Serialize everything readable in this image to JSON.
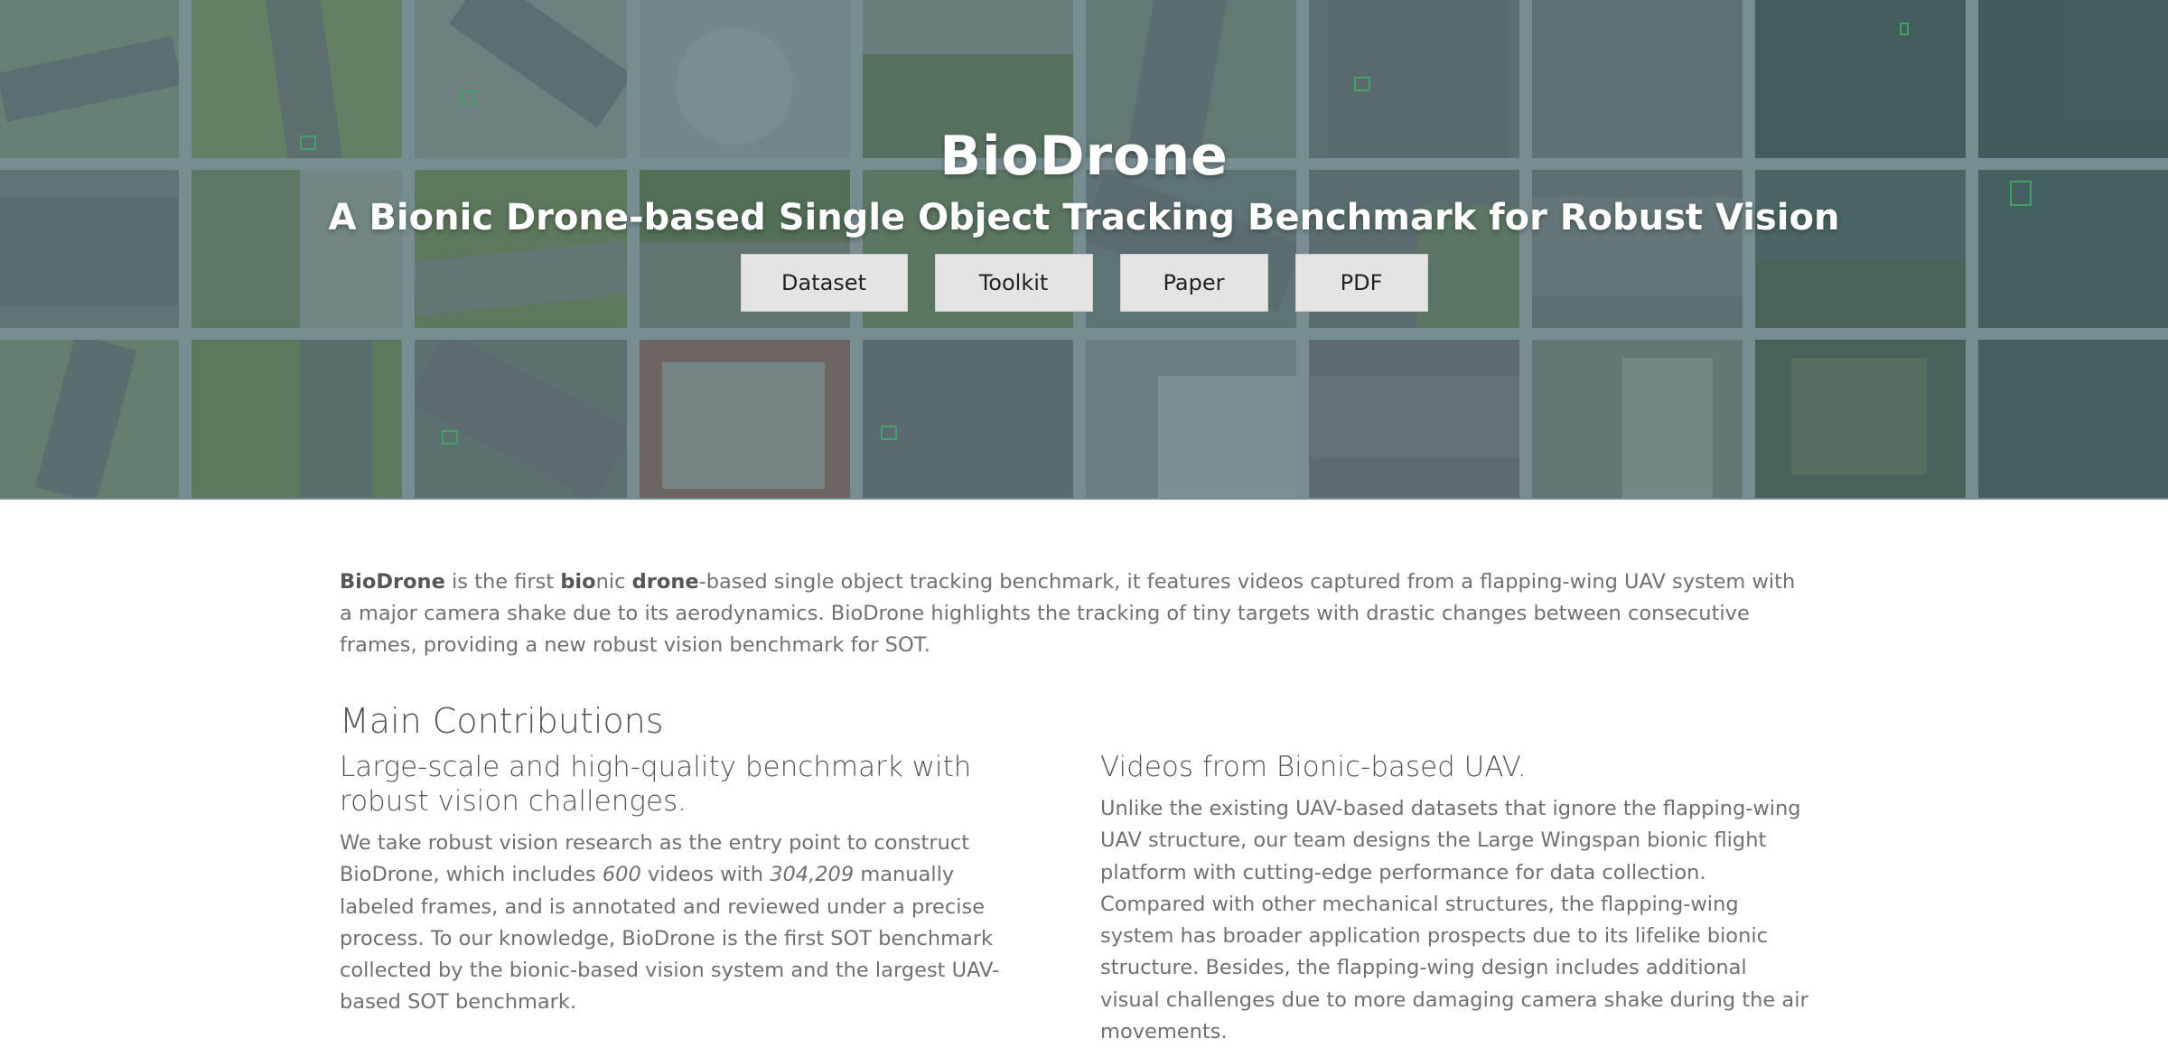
{
  "hero": {
    "title": "BioDrone",
    "subtitle": "A Bionic Drone-based Single Object Tracking Benchmark for Robust Vision",
    "buttons": [
      "Dataset",
      "Toolkit",
      "Paper",
      "PDF"
    ]
  },
  "intro": {
    "name_bold": "BioDrone",
    "part1": " is the first ",
    "bio_bold": "bio",
    "part2": "nic ",
    "drone_bold": "drone",
    "part3": "-based single object tracking benchmark, it features videos captured from a flapping-wing UAV system with a major camera shake due to its aerodynamics. BioDrone highlights the tracking of tiny targets with drastic changes between consecutive frames, providing a new robust vision benchmark for SOT."
  },
  "main": {
    "section_title": "Main Contributions",
    "left": {
      "heading": "Large-scale and high-quality benchmark with robust vision challenges.",
      "p1": "We take robust vision research as the entry point to construct BioDrone, which includes ",
      "videos_count": "600",
      "p2": " videos with ",
      "frames_count": "304,209",
      "p3": " manually labeled frames, and is annotated and reviewed under a precise process. To our knowledge, BioDrone is the first SOT benchmark collected by the bionic-based vision system and the largest UAV-based SOT benchmark."
    },
    "right": {
      "heading": "Videos from Bionic-based UAV.",
      "body": "Unlike the existing UAV-based datasets that ignore the flapping-wing UAV structure, our team designs the Large Wingspan bionic flight platform with cutting-edge performance for data collection. Compared with other mechanical structures, the flapping-wing system has broader application prospects due to its lifelike bionic structure. Besides, the flapping-wing design includes additional visual challenges due to more damaging camera shake during the air movements."
    }
  }
}
